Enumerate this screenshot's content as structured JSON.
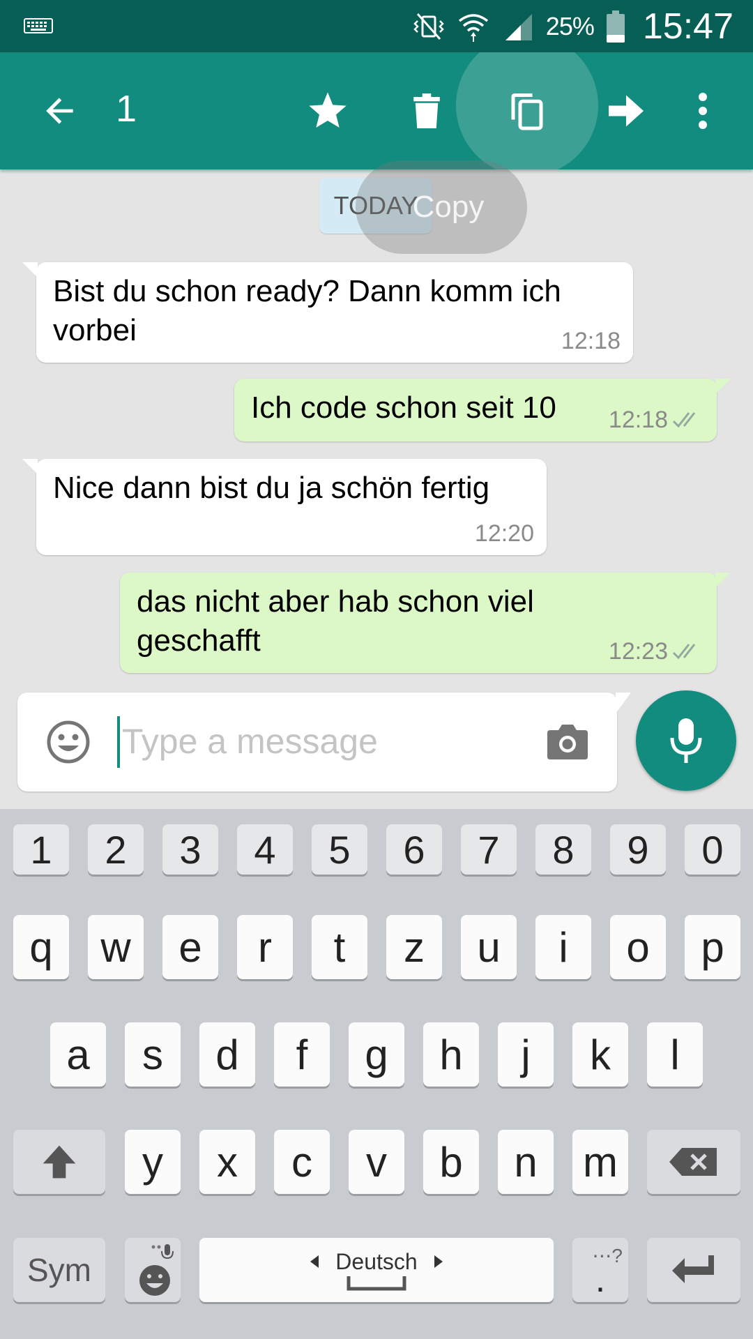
{
  "status_bar": {
    "battery": "25%",
    "time": "15:47",
    "icons": [
      "keyboard-icon",
      "vibrate-icon",
      "wifi-icon",
      "signal-icon",
      "battery-icon"
    ]
  },
  "action_bar": {
    "selected_count": "1",
    "icons": [
      "back-arrow-icon",
      "star-icon",
      "delete-icon",
      "copy-icon",
      "forward-icon",
      "more-icon"
    ]
  },
  "tooltip": {
    "label": "Copy"
  },
  "chat": {
    "date_badge": "TODAY",
    "messages": [
      {
        "direction": "incoming",
        "line1": "Bist du schon ready? Dann komm ich",
        "line2": "vorbei",
        "time": "12:18"
      },
      {
        "direction": "outgoing",
        "line1": "Ich code schon seit 10",
        "line2": "",
        "time": "12:18",
        "read": true
      },
      {
        "direction": "incoming",
        "line1": "Nice dann bist du ja schön fertig",
        "line2": "",
        "time": "12:20"
      },
      {
        "direction": "outgoing",
        "line1": "das nicht aber hab schon viel",
        "line2": "geschafft",
        "time": "12:23",
        "read": true
      }
    ]
  },
  "composer": {
    "placeholder": "Type a message",
    "value": ""
  },
  "keyboard": {
    "row_numbers": [
      "1",
      "2",
      "3",
      "4",
      "5",
      "6",
      "7",
      "8",
      "9",
      "0"
    ],
    "row1": [
      "q",
      "w",
      "e",
      "r",
      "t",
      "z",
      "u",
      "i",
      "o",
      "p"
    ],
    "row2": [
      "a",
      "s",
      "d",
      "f",
      "g",
      "h",
      "j",
      "k",
      "l"
    ],
    "row3": [
      "y",
      "x",
      "c",
      "v",
      "b",
      "n",
      "m"
    ],
    "sym_label": "Sym",
    "language": "Deutsch",
    "period_key": "."
  },
  "colors": {
    "status_bar": "#075e54",
    "action_bar": "#128c7e",
    "outgoing_bubble": "#dcf8c6",
    "incoming_bubble": "#ffffff",
    "chat_background": "#e4e4e4",
    "keyboard_background": "#c8cbcf"
  }
}
